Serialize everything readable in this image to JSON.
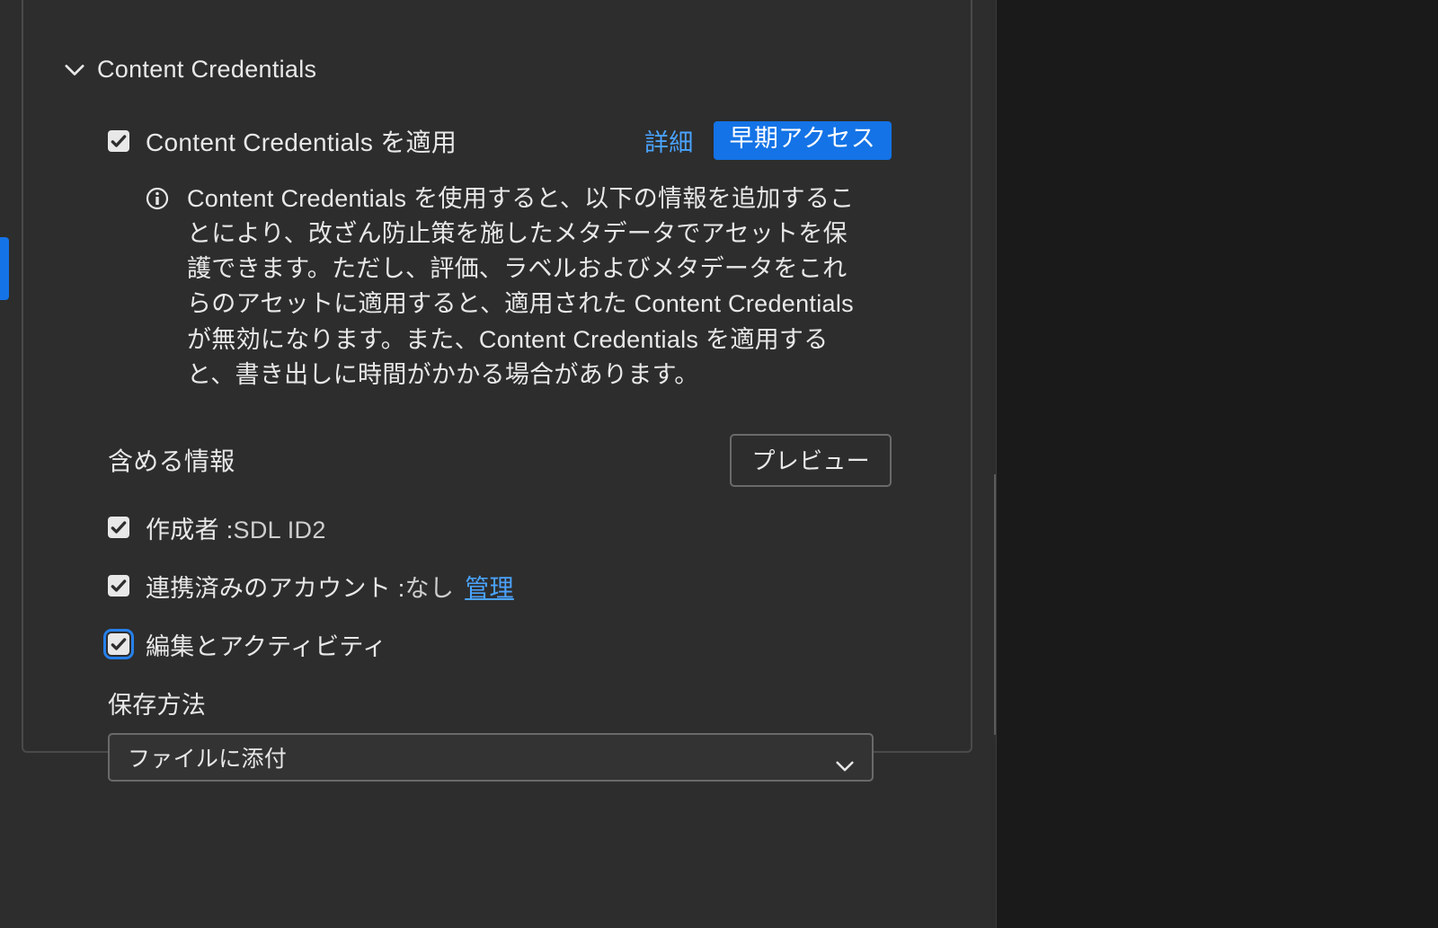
{
  "section": {
    "title": "Content Credentials",
    "apply_label": "Content Credentials を適用",
    "details_link": "詳細",
    "badge": "早期アクセス",
    "info_text": "Content Credentials を使用すると、以下の情報を追加することにより、改ざん防止策を施したメタデータでアセットを保護できます。ただし、評価、ラベルおよびメタデータをこれらのアセットに適用すると、適用された Content Credentials が無効になります。また、Content Credentials を適用すると、書き出しに時間がかかる場合があります。"
  },
  "include": {
    "title": "含める情報",
    "preview_button": "プレビュー",
    "items": {
      "creator_label": "作成者 :",
      "creator_value": "SDL ID2",
      "account_label": "連携済みのアカウント :",
      "account_value": "なし",
      "account_manage_link": "管理",
      "activity_label": "編集とアクティビティ"
    }
  },
  "save": {
    "title": "保存方法",
    "selected_option": "ファイルに添付"
  }
}
